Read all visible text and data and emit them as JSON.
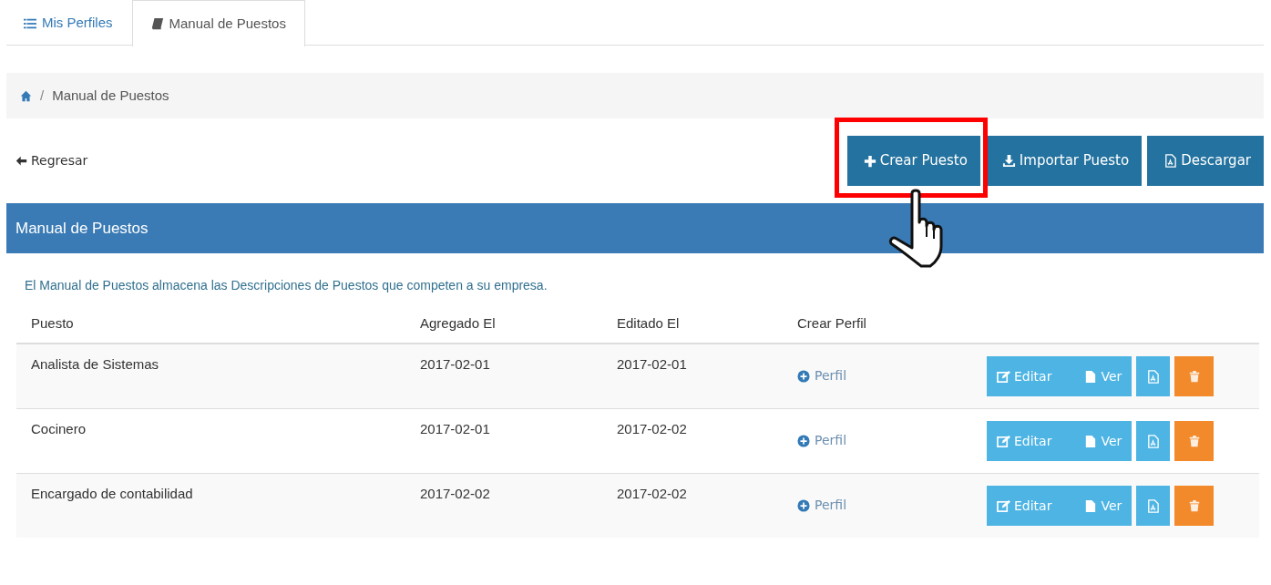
{
  "tabs": [
    {
      "label": "Mis Perfiles",
      "selected": false
    },
    {
      "label": "Manual de Puestos",
      "selected": true
    }
  ],
  "breadcrumb": [
    "Manual de Puestos"
  ],
  "breadcrumb_separator": "/",
  "back_link": "Regresar",
  "toolbar_buttons": [
    {
      "label": "Crear Puesto",
      "highlighted": true
    },
    {
      "label": "Importar Puesto",
      "highlighted": false
    },
    {
      "label": "Descargar",
      "highlighted": false
    }
  ],
  "panel": {
    "title": "Manual de Puestos",
    "description": "El Manual de Puestos almacena las Descripciones de Puestos que competen a su empresa."
  },
  "table": {
    "columns": [
      "Puesto",
      "Agregado El",
      "Editado El",
      "Crear Perfil"
    ],
    "rows": [
      {
        "puesto": "Analista de Sistemas",
        "agregado": "2017-02-01",
        "editado": "2017-02-01",
        "perfil": "Perfil",
        "edit": "Editar",
        "view": "Ver"
      },
      {
        "puesto": "Cocinero",
        "agregado": "2017-02-01",
        "editado": "2017-02-02",
        "perfil": "Perfil",
        "edit": "Editar",
        "view": "Ver"
      },
      {
        "puesto": "Encargado de contabilidad",
        "agregado": "2017-02-02",
        "editado": "2017-02-02",
        "perfil": "Perfil",
        "edit": "Editar",
        "view": "Ver"
      }
    ]
  }
}
